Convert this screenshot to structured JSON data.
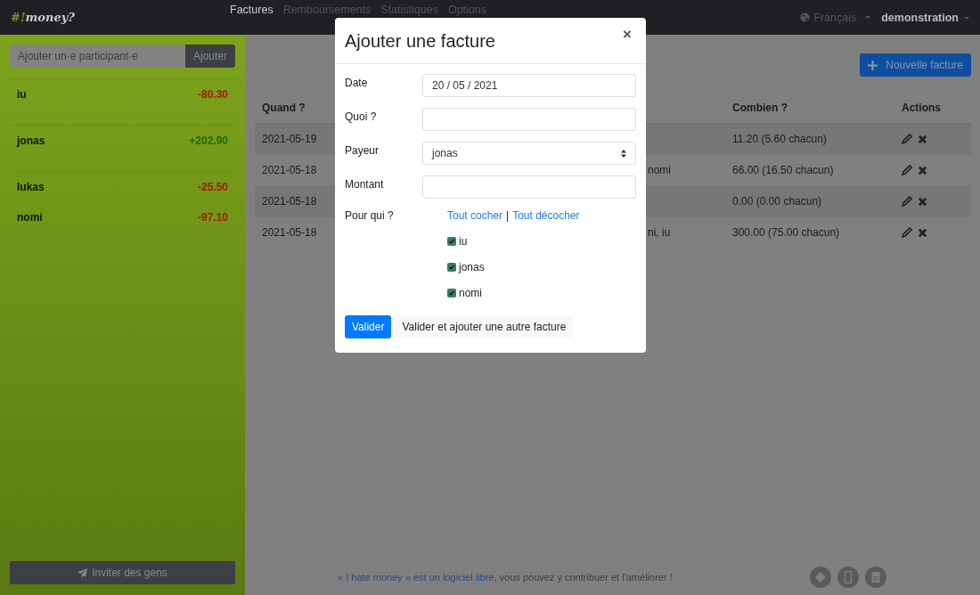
{
  "navbar": {
    "brand": {
      "symbol": "#!",
      "name": "money?"
    },
    "links": [
      {
        "label": "Factures",
        "selected": true
      },
      {
        "label": "Remboursements",
        "selected": false
      },
      {
        "label": "Statistiques",
        "selected": false
      },
      {
        "label": "Options",
        "selected": false
      }
    ],
    "language": "Français",
    "user": "demonstration"
  },
  "sidebar": {
    "add_field": {
      "placeholder": "Ajouter un·e participant·e"
    },
    "add_button": "Ajouter",
    "participants": [
      {
        "name": "iu",
        "balance": "-80.30",
        "color": "#a01c00"
      },
      {
        "name": "jonas",
        "balance": "+202.90",
        "color": "#1c6a00"
      },
      {
        "name": "lukas",
        "balance": "-25.50",
        "color": "#a01c00"
      },
      {
        "name": "nomi",
        "balance": "-97.10",
        "color": "#a01c00"
      }
    ],
    "invite_button": "Inviter des gens"
  },
  "main": {
    "new_bill_button": "Nouvelle facture",
    "table": {
      "columns": [
        "Quand ?",
        "Combien ?",
        "Actions"
      ],
      "rows": [
        {
          "date": "2021-05-19",
          "amount": "11.20 (5.60 chacun)"
        },
        {
          "date": "2021-05-18",
          "column_3": "nomi",
          "amount": "66.00 (16.50 chacun)"
        },
        {
          "date": "2021-05-18",
          "amount": "0.00 (0.00 chacun)"
        },
        {
          "date": "2021-05-18",
          "column_3": "ni, iu",
          "amount": "300.00 (75.00 chacun)"
        }
      ]
    },
    "footer": {
      "link": "« I hate money » est un logiciel libre",
      "text": ", vous pouvez y contribuer et l'améliorer !"
    }
  },
  "modal": {
    "title": "Ajouter une facture",
    "close": "×",
    "fields": [
      {
        "label": "Date",
        "kind": "input",
        "value": "20 / 05 / 2021"
      },
      {
        "label": "Quoi ?",
        "kind": "input"
      },
      {
        "label": "Payeur",
        "kind": "select",
        "value": "jonas"
      },
      {
        "label": "Montant",
        "kind": "input"
      }
    ],
    "for_whom": {
      "label": "Pour qui ?",
      "check_all": "Tout cocher",
      "separator": "|",
      "uncheck_all": "Tout décocher",
      "people": [
        {
          "name": "iu",
          "checked": true
        },
        {
          "name": "jonas",
          "checked": true
        },
        {
          "name": "nomi",
          "checked": true
        }
      ]
    },
    "buttons": [
      {
        "label": "Valider",
        "kind": "primary"
      },
      {
        "label": "Valider et ajouter une autre facture",
        "kind": "secondary"
      }
    ]
  }
}
